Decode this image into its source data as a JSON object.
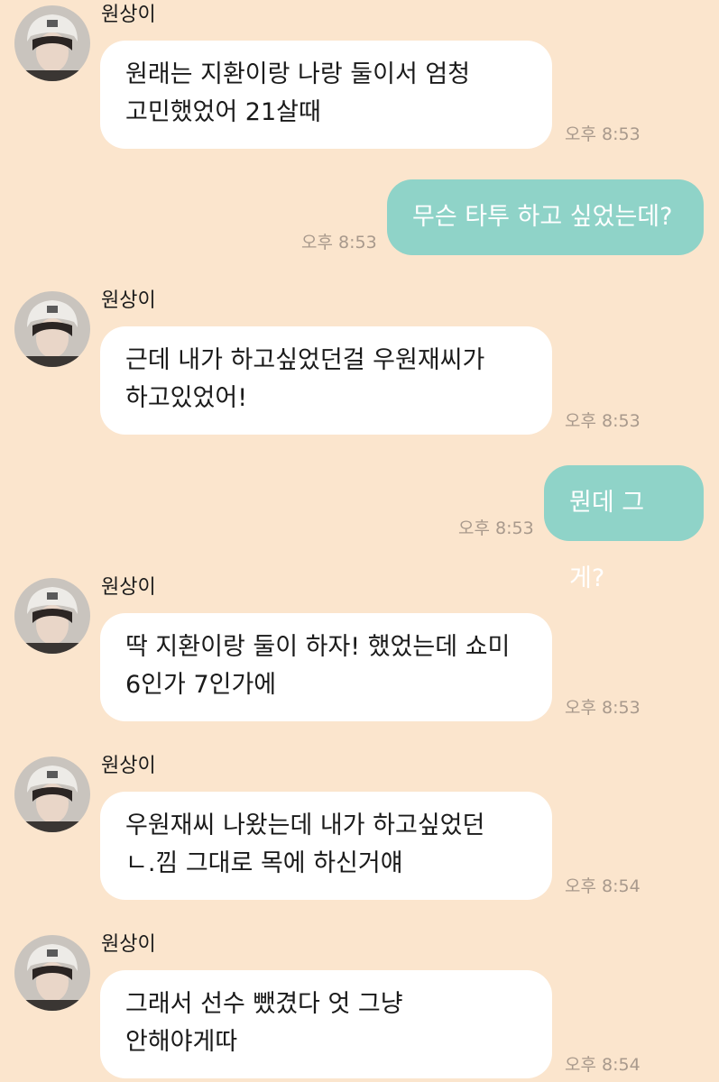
{
  "messages": [
    {
      "sender": "원상이",
      "side": "in",
      "text": "원래는 지환이랑 나랑 둘이서 엄청\n고민했었어 21살때",
      "time": "오후 8:53"
    },
    {
      "side": "out",
      "text": "무슨 타투 하고 싶었는데?",
      "time": "오후 8:53"
    },
    {
      "sender": "원상이",
      "side": "in",
      "text": "근데 내가 하고싶었던걸 우원재씨가\n하고있었어!",
      "time": "오후 8:53"
    },
    {
      "side": "out",
      "text": "뭔데 그게?",
      "time": "오후 8:53"
    },
    {
      "sender": "원상이",
      "side": "in",
      "text": "딱 지환이랑 둘이 하자! 했었는데 쇼미\n6인가 7인가에",
      "time": "오후 8:53"
    },
    {
      "sender": "원상이",
      "side": "in",
      "text": "우원재씨 나왔는데 내가 하고싶었던\nㄴ.낌 그대로 목에 하신거얘",
      "time": "오후 8:54"
    },
    {
      "sender": "원상이",
      "side": "in",
      "text": "그래서 선수 뺐겼다 엇 그냥\n안해야게따",
      "time": "오후 8:54"
    }
  ],
  "colors": {
    "background": "#FBE5CD",
    "incoming_bubble": "#FFFFFF",
    "outgoing_bubble": "#8FD3C8",
    "timestamp": "#A8998C"
  },
  "icons": {
    "avatar": "profile-photo"
  }
}
